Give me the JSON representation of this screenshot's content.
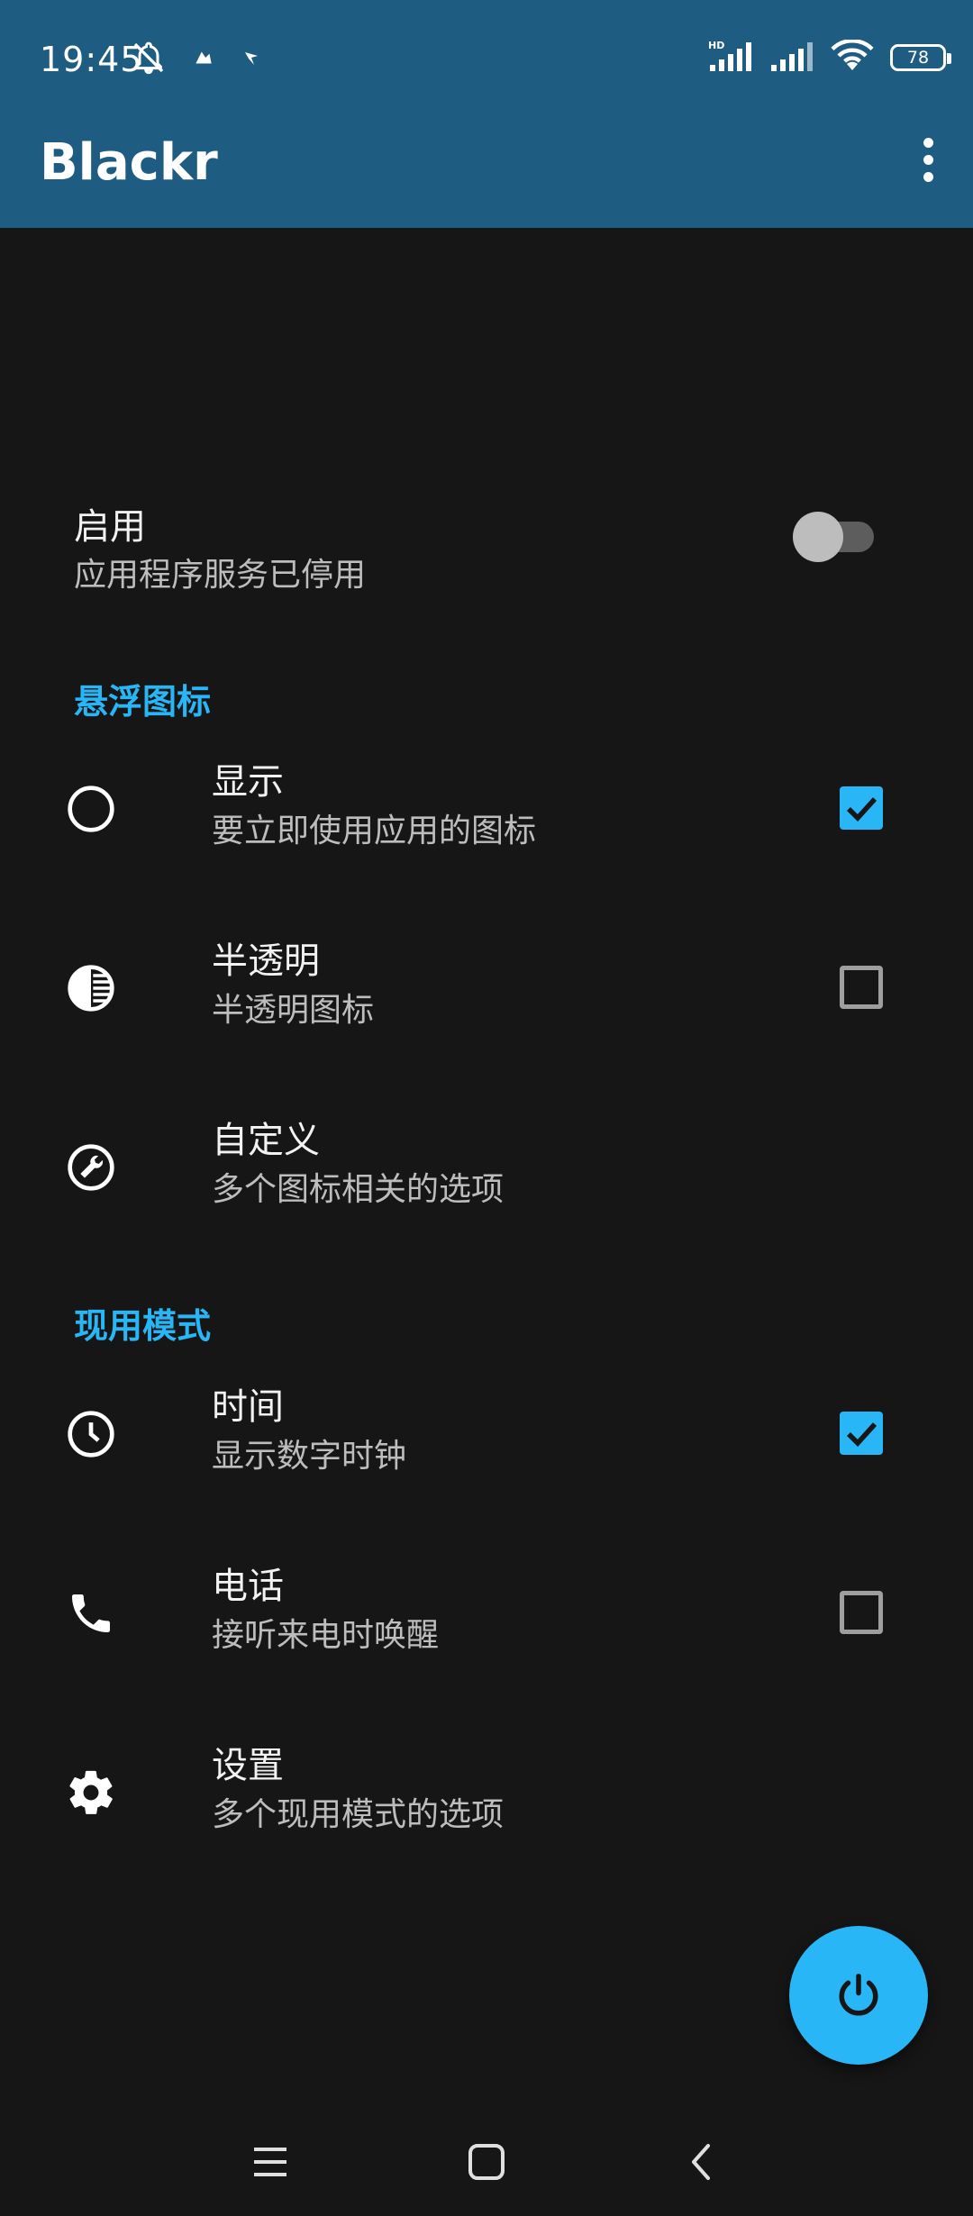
{
  "status_bar": {
    "time": "19:45",
    "battery": "78"
  },
  "app_bar": {
    "title": "Blackr"
  },
  "enable": {
    "title": "启用",
    "subtitle": "应用程序服务已停用",
    "enabled": false
  },
  "sections": [
    {
      "header": "悬浮图标",
      "items": [
        {
          "title": "显示",
          "subtitle": "要立即使用应用的图标",
          "icon": "circle-outline-icon",
          "checkbox": "checked"
        },
        {
          "title": "半透明",
          "subtitle": "半透明图标",
          "icon": "opacity-icon",
          "checkbox": "unchecked"
        },
        {
          "title": "自定义",
          "subtitle": "多个图标相关的选项",
          "icon": "wrench-icon",
          "checkbox": "none"
        }
      ]
    },
    {
      "header": "现用模式",
      "items": [
        {
          "title": "时间",
          "subtitle": "显示数字时钟",
          "icon": "clock-icon",
          "checkbox": "checked"
        },
        {
          "title": "电话",
          "subtitle": "接听来电时唤醒",
          "icon": "phone-icon",
          "checkbox": "unchecked"
        },
        {
          "title": "设置",
          "subtitle": "多个现用模式的选项",
          "icon": "gear-icon",
          "checkbox": "none"
        }
      ]
    }
  ],
  "colors": {
    "app_bar": "#1e5c82",
    "background": "#161616",
    "accent": "#29b6f6"
  },
  "fab": {
    "icon": "power-icon"
  }
}
